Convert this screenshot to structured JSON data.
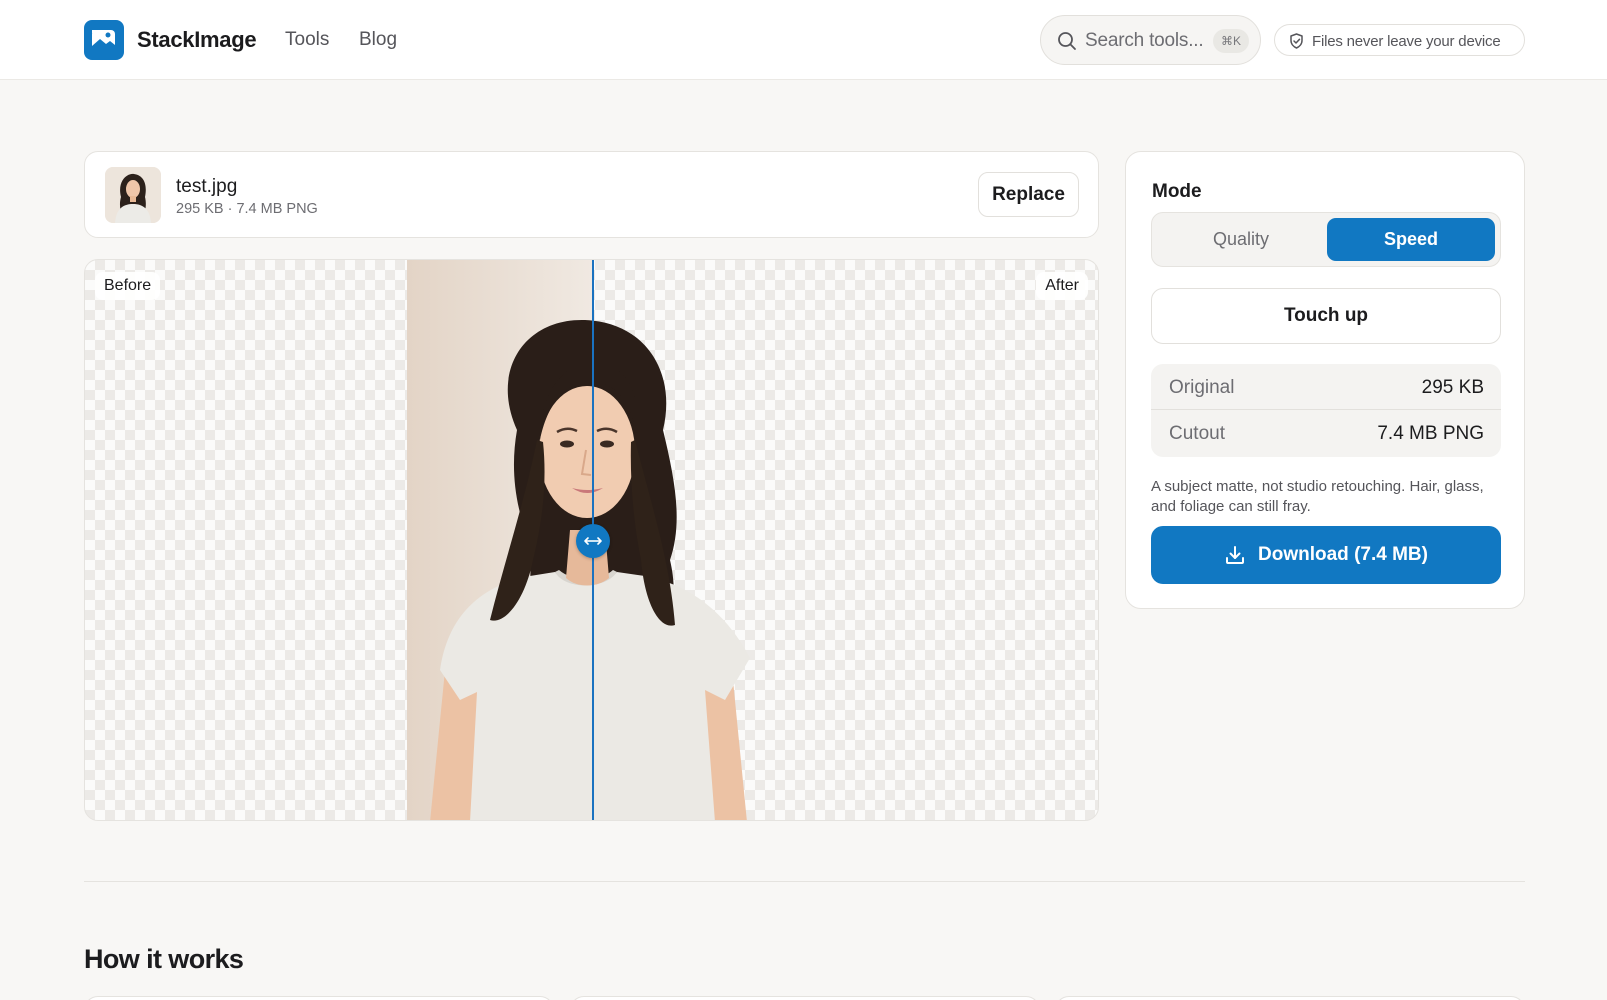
{
  "header": {
    "brand": "StackImage",
    "nav": [
      {
        "label": "Tools"
      },
      {
        "label": "Blog"
      }
    ],
    "search": {
      "placeholder": "Search tools...",
      "shortcut": "⌘K"
    },
    "privacy_badge": "Files never leave your device"
  },
  "file": {
    "name": "test.jpg",
    "meta": "295 KB · 7.4 MB PNG",
    "replace_label": "Replace"
  },
  "viewer": {
    "before_label": "Before",
    "after_label": "After",
    "divider_position": 0.5
  },
  "panel": {
    "mode_title": "Mode",
    "modes": [
      {
        "label": "Quality",
        "selected": false
      },
      {
        "label": "Speed",
        "selected": true
      }
    ],
    "touch_up_label": "Touch up",
    "stats": [
      {
        "label": "Original",
        "value": "295 KB"
      },
      {
        "label": "Cutout",
        "value": "7.4 MB PNG"
      }
    ],
    "note": "A subject matte, not studio retouching. Hair, glass, and foliage can still fray.",
    "download_label": "Download (7.4 MB)"
  },
  "how_it_works": {
    "title": "How it works"
  },
  "colors": {
    "accent": "#1178c2",
    "page_bg": "#f8f7f5",
    "card_bg": "#ffffff"
  },
  "icons": [
    "logo-icon",
    "search-icon",
    "shield-icon",
    "compare-arrows-icon",
    "download-icon"
  ]
}
